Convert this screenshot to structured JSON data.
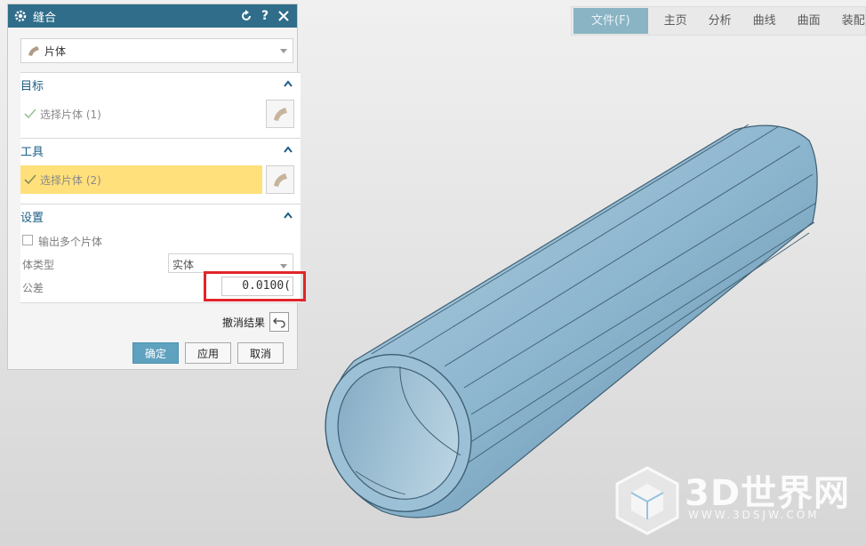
{
  "dialog": {
    "title": "缝合",
    "type_select": "片体",
    "sections": {
      "target": {
        "title": "目标",
        "pick_label": "选择片体 (1)"
      },
      "tool": {
        "title": "工具",
        "pick_label": "选择片体 (2)"
      },
      "settings": {
        "title": "设置",
        "multi_output_label": "输出多个片体",
        "body_type_label": "体类型",
        "body_type_value": "实体",
        "tolerance_label": "公差",
        "tolerance_value": "0.0100("
      }
    },
    "undo_label": "撤消结果",
    "buttons": {
      "ok": "确定",
      "apply": "应用",
      "cancel": "取消"
    }
  },
  "ribbon": {
    "tabs": [
      "文件(F)",
      "主页",
      "分析",
      "曲线",
      "曲面",
      "装配"
    ]
  },
  "watermark": {
    "brand": "3D世界网",
    "url": "WWW.3DSJW.COM"
  },
  "colors": {
    "title_bar": "#2f6d8a",
    "highlight_row": "#ffe07a",
    "primary_button": "#5fa2c0",
    "callout_box": "#e1252a",
    "model_fill": "#8fb6cf"
  }
}
